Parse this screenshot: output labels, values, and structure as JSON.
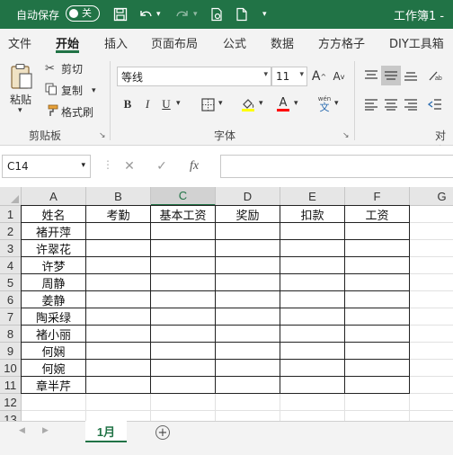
{
  "titlebar": {
    "autosave_label": "自动保存",
    "autosave_toggle": "关",
    "doc_title": "工作簿1 -",
    "bg_color": "#217346",
    "icons": [
      "save-icon",
      "undo-icon",
      "redo-icon",
      "print-preview-icon",
      "new-doc-icon",
      "customize-icon"
    ]
  },
  "tabs": [
    "文件",
    "开始",
    "插入",
    "页面布局",
    "公式",
    "数据",
    "方方格子",
    "DIY工具箱"
  ],
  "active_tab": "开始",
  "ribbon": {
    "clipboard": {
      "paste": "粘贴",
      "cut": "剪切",
      "copy": "复制",
      "format_painter": "格式刷",
      "group_label": "剪贴板"
    },
    "font": {
      "font_name": "等线",
      "font_size": "11",
      "bold": "B",
      "italic": "I",
      "underline": "U",
      "group_label": "字体",
      "fill_color": "#ffff00",
      "font_color": "#ff0000",
      "phonetic": "wén"
    },
    "align": {
      "group_label": "对齐"
    }
  },
  "formula_bar": {
    "name_box": "C14",
    "cancel": "✕",
    "enter": "✓",
    "fx": "fx",
    "formula": ""
  },
  "sheet": {
    "columns": [
      "A",
      "B",
      "C",
      "D",
      "E",
      "F",
      "G"
    ],
    "selected_column": "C",
    "rows": [
      "1",
      "2",
      "3",
      "4",
      "5",
      "6",
      "7",
      "8",
      "9",
      "10",
      "11",
      "12",
      "13"
    ],
    "headers": [
      "姓名",
      "考勤",
      "基本工资",
      "奖励",
      "扣款",
      "工资"
    ],
    "names": [
      "褚开萍",
      "许翠花",
      "许梦",
      "周静",
      "姜静",
      "陶采绿",
      "褚小丽",
      "何娴",
      "何婉",
      "章半芹"
    ]
  },
  "sheet_tabs": {
    "active": "1月",
    "add_label": "+"
  }
}
